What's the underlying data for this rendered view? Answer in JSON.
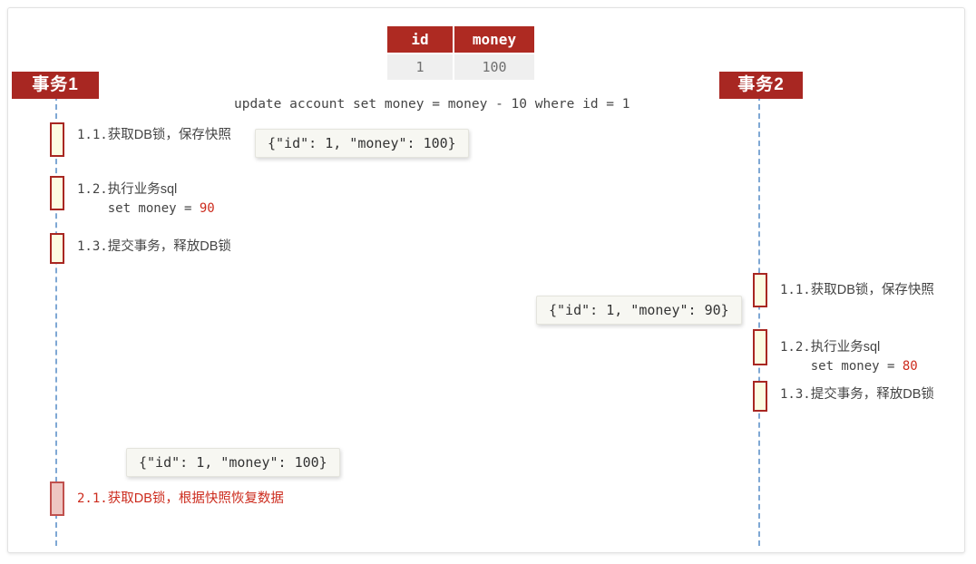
{
  "diagram": {
    "type": "sequence-diagram",
    "title_sql": "update account set money = money - 10 where id = 1",
    "table": {
      "headers": [
        "id",
        "money"
      ],
      "rows": [
        [
          "1",
          "100"
        ]
      ]
    },
    "actors": [
      {
        "id": "tx1",
        "label": "事务1"
      },
      {
        "id": "tx2",
        "label": "事务2"
      }
    ],
    "left_steps": [
      {
        "num": "1.1.",
        "text": "获取DB锁，保存快照"
      },
      {
        "num": "1.2.",
        "text": "执行业务sql",
        "sub_prefix": "    set money = ",
        "sub_value": "90"
      },
      {
        "num": "1.3.",
        "text": "提交事务，释放DB锁"
      }
    ],
    "right_steps": [
      {
        "num": "1.1.",
        "text": "获取DB锁，保存快照"
      },
      {
        "num": "1.2.",
        "text": "执行业务sql",
        "sub_prefix": "    set money = ",
        "sub_value": "80"
      },
      {
        "num": "1.3.",
        "text": "提交事务，释放DB锁"
      }
    ],
    "rollback_step": {
      "num": "2.1.",
      "text": "获取DB锁，根据快照恢复数据"
    },
    "snapshots": [
      {
        "id": "snapshot-top",
        "text": "{\"id\": 1, \"money\": 100}"
      },
      {
        "id": "snapshot-middle",
        "text": "{\"id\": 1, \"money\": 90}"
      },
      {
        "id": "snapshot-bottom",
        "text": "{\"id\": 1, \"money\": 100}"
      }
    ],
    "colors": {
      "accent_red": "#a82722",
      "lifeline_blue": "#7fa8d4",
      "activation_fill": "#fcfce2",
      "rollback_fill": "#eec6c2",
      "value_red": "#cc2b1d",
      "text_gray": "#444444"
    }
  }
}
